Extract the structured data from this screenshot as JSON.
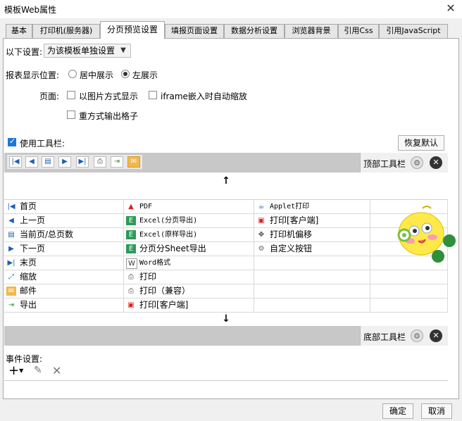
{
  "window": {
    "title": "模板Web属性"
  },
  "tabs": [
    "基本",
    "打印机(服务器)",
    "分页预览设置",
    "填报页面设置",
    "数据分析设置",
    "浏览器背景",
    "引用Css",
    "引用JavaScript"
  ],
  "settings": {
    "label": "以下设置:",
    "value": "为该模板单独设置"
  },
  "position": {
    "label": "报表显示位置:",
    "opt1": "居中展示",
    "opt2": "左展示"
  },
  "page": {
    "label": "页面:",
    "opt_image": "以图片方式显示",
    "opt_iframe": "iframe嵌入时自动缩放",
    "opt_cells": "重方式输出格子"
  },
  "toolbar": {
    "use_label": "使用工具栏:",
    "restore": "恢复默认",
    "top_label": "顶部工具栏",
    "bottom_label": "底部工具栏"
  },
  "grid": {
    "col1": [
      "首页",
      "上一页",
      "当前页/总页数",
      "下一页",
      "末页",
      "缩放",
      "邮件",
      "导出"
    ],
    "col2": [
      "PDF",
      "Excel(分页导出)",
      "Excel(原样导出)",
      "分页分Sheet导出",
      "Word格式",
      "打印",
      "打印（兼容）",
      "打印[客户端]"
    ],
    "col3": [
      "Applet打印",
      "打印[客户端]",
      "打印机偏移",
      "自定义按钮"
    ]
  },
  "events": {
    "label": "事件设置:"
  },
  "footer": {
    "ok": "确定",
    "cancel": "取消"
  }
}
